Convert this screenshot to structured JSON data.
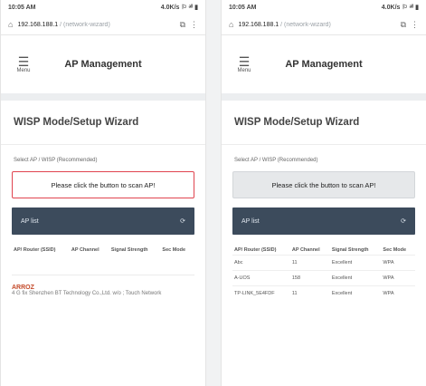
{
  "screens": [
    {
      "status": {
        "time": "10:05 AM",
        "icons": "4.0K/s ⚐ ᵃˡˡ ▮"
      },
      "url": {
        "host": "192.168.188.1",
        "rest": " / (network-wizard)"
      },
      "header": {
        "menu_label": "Menu",
        "title": "AP Management"
      },
      "wizard_title": "WISP Mode/Setup Wizard",
      "section_label": "Select AP / WISP (Recommended)",
      "scan_button": "Please click the button to scan AP!",
      "ap_bar": {
        "label": "AP list",
        "action_icon": "refresh-icon"
      },
      "table": {
        "headers": [
          "AP/ Router (SSID)",
          "AP Channel",
          "Signal Strength",
          "Sec Mode"
        ],
        "rows": []
      },
      "found_ap": {
        "name": "ARROZ",
        "maker": "4 G fix Shenzhen BT Technology Co.,Ltd. w/o ; Touch Network"
      }
    },
    {
      "status": {
        "time": "10:05 AM",
        "icons": "4.0K/s ⚐ ᵃˡˡ ▮"
      },
      "url": {
        "host": "192.168.188.1",
        "rest": " / (network-wizard)"
      },
      "header": {
        "menu_label": "Menu",
        "title": "AP Management"
      },
      "wizard_title": "WISP Mode/Setup Wizard",
      "section_label": "Select AP / WISP (Recommended)",
      "scan_button": "Please click the button to scan AP!",
      "ap_bar": {
        "label": "AP list",
        "action_icon": "refresh-icon"
      },
      "table": {
        "headers": [
          "AP/ Router (SSID)",
          "AP Channel",
          "Signal Strength",
          "Sec Mode"
        ],
        "rows": [
          [
            "Abc",
            "11",
            "Excellent",
            "WPA"
          ],
          [
            "A-UOS",
            "158",
            "Excellent",
            "WPA"
          ],
          [
            "TP-LINK_5E4FDF",
            "11",
            "Excellent",
            "WPA"
          ]
        ]
      }
    }
  ],
  "colors": {
    "accent_border": "#e0444f",
    "ap_bar_bg": "#3c4b5c",
    "found_name": "#c44a2a"
  }
}
